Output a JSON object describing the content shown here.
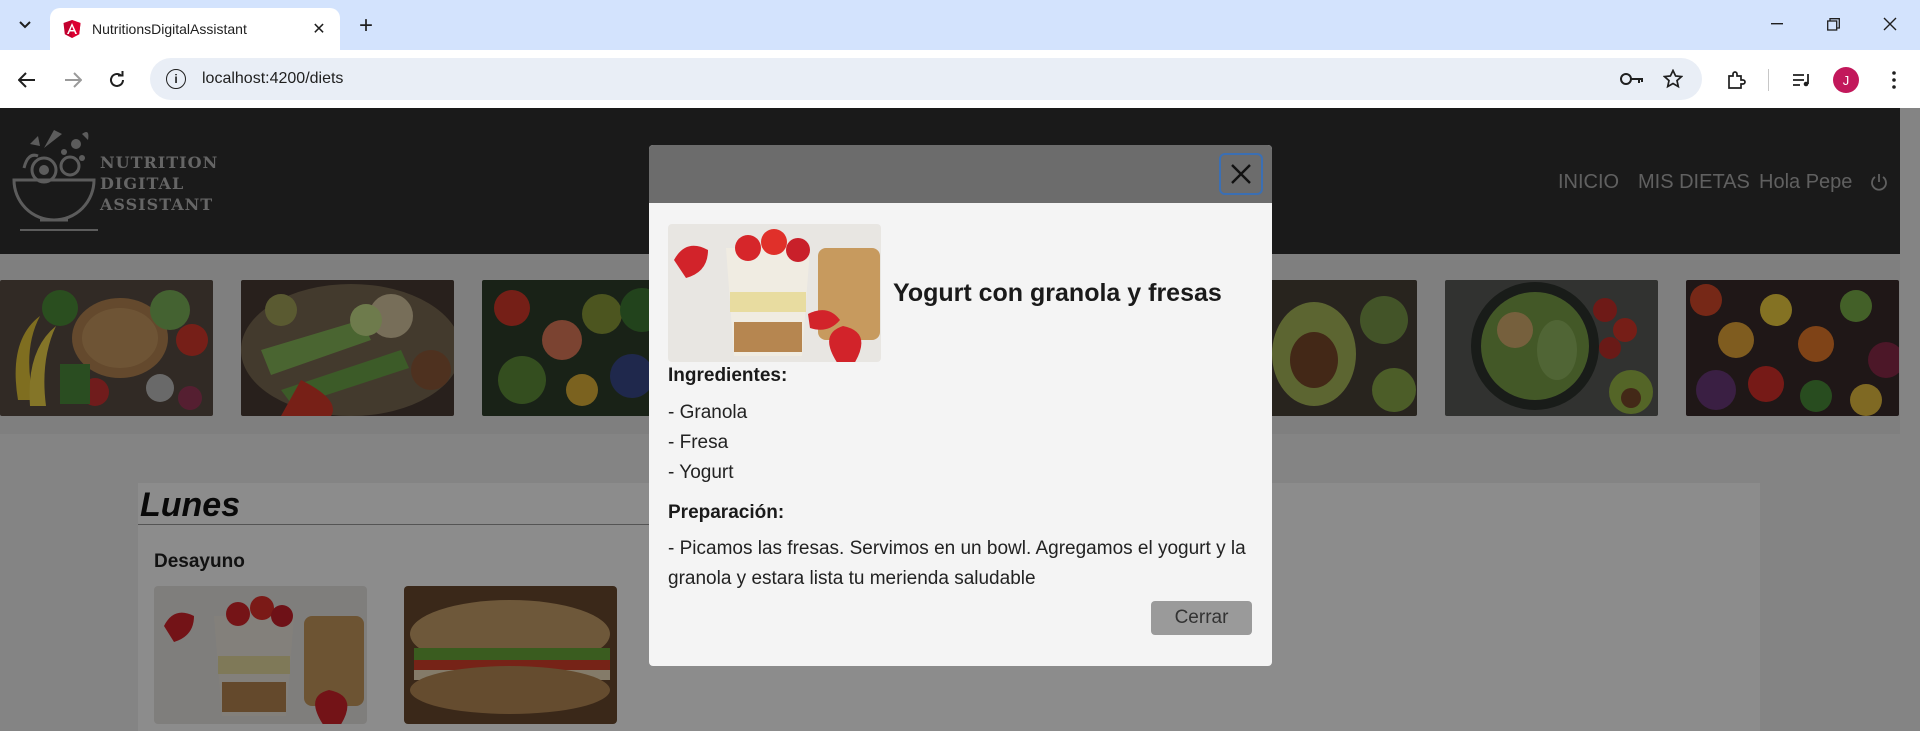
{
  "browser": {
    "tab_title": "NutritionsDigitalAssistant",
    "url": "localhost:4200/diets",
    "avatar_letter": "J"
  },
  "app": {
    "logo_text": [
      "NUTRITION",
      "DIGITAL",
      "ASSISTANT"
    ],
    "nav": {
      "home": "INICIO",
      "diets": "MIS DIETAS",
      "greeting": "Hola Pepe"
    }
  },
  "day": {
    "title": "Lunes",
    "meal": "Desayuno"
  },
  "modal": {
    "title": "Yogurt con granola y fresas",
    "ingredients_label": "Ingredientes:",
    "ingredients": [
      "- Granola",
      "- Fresa",
      "- Yogurt"
    ],
    "preparation_label": "Preparación:",
    "preparation": "- Picamos las fresas. Servimos en un bowl. Agregamos el yogurt y la granola y estara lista tu merienda saludable",
    "close_label": "Cerrar"
  },
  "colors": {
    "header_bg": "#303030",
    "modal_header_bg": "#6c6c6c",
    "close_button_bg": "#9a9a9a",
    "focus_ring": "#3b6fb3",
    "avatar_bg": "#c2185b"
  }
}
